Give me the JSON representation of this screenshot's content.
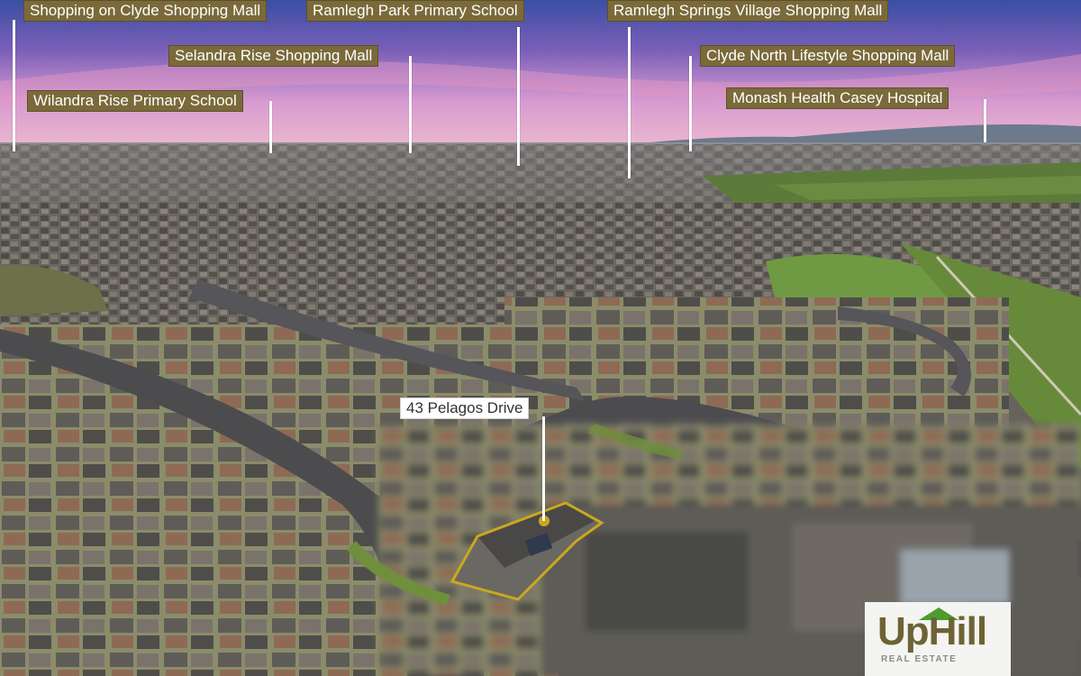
{
  "labels": {
    "shopping_on_clyde": "Shopping on Clyde Shopping Mall",
    "ramlegh_park_school": "Ramlegh Park Primary School",
    "ramlegh_springs": "Ramlegh Springs Village Shopping Mall",
    "selandra_rise": "Selandra Rise Shopping Mall",
    "clyde_north_lifestyle": "Clyde North Lifestyle Shopping Mall",
    "wilandra_rise_school": "Wilandra Rise Primary School",
    "monash_health": "Monash Health Casey Hospital",
    "subject_property": "43 Pelagos Drive"
  },
  "logo": {
    "wordmark": "UpHill",
    "subtitle": "REAL ESTATE"
  },
  "colors": {
    "label_bg": "#7a6a3a",
    "label_text": "#ffffff",
    "subject_label_bg": "#ffffff",
    "boundary_outline": "#c9a81e",
    "logo_text": "#6e6334",
    "logo_roof": "#4e9b2e"
  }
}
